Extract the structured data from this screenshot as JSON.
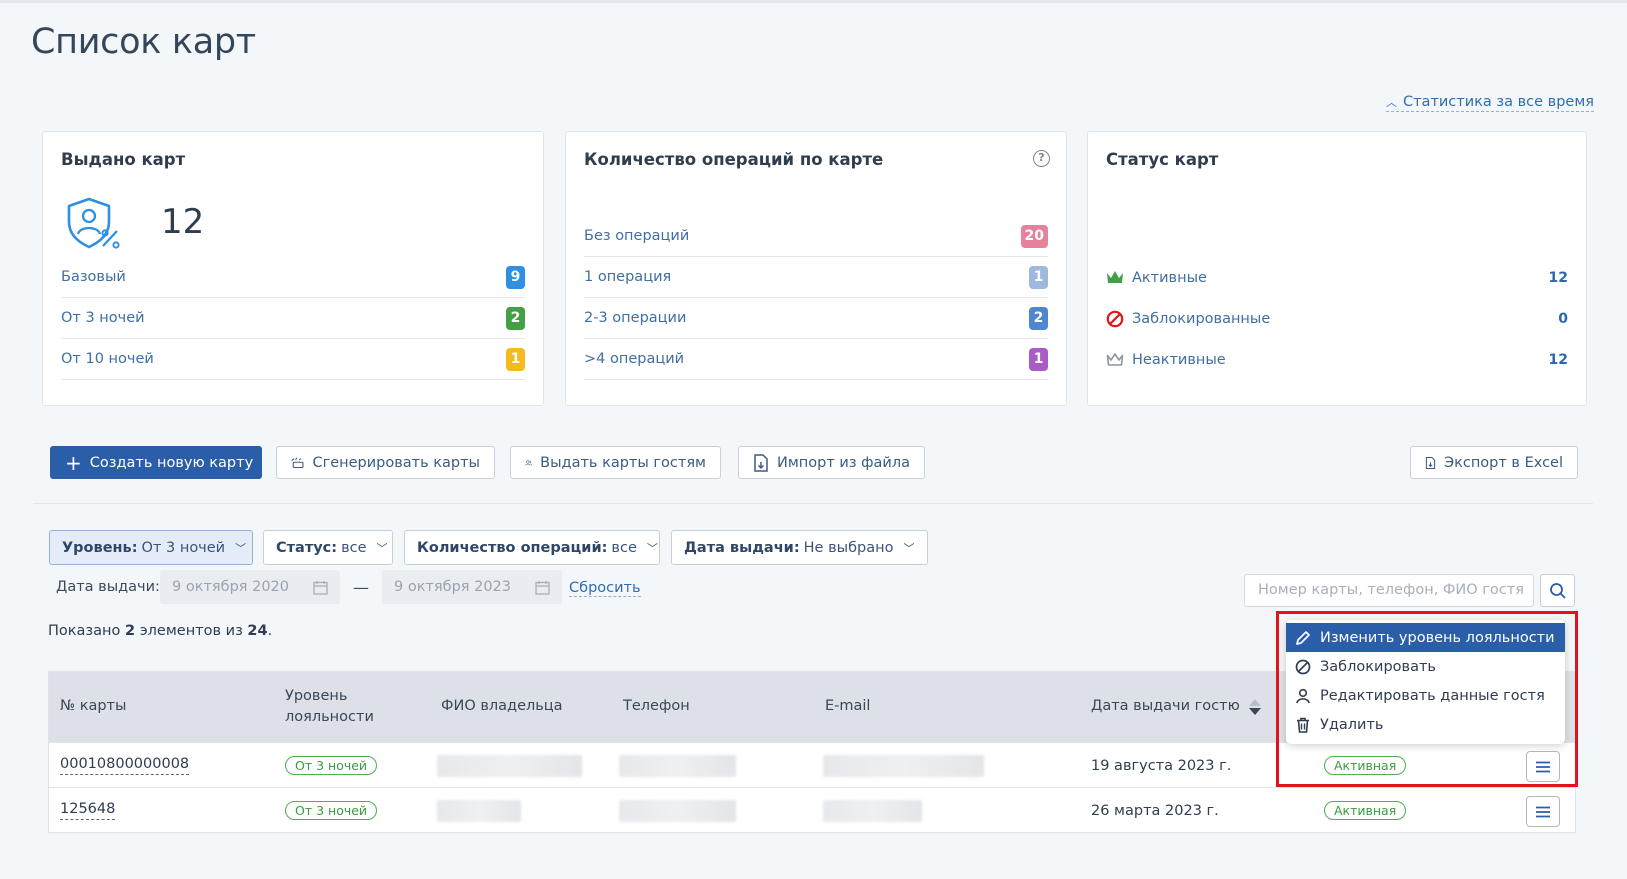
{
  "page": {
    "title": "Список карт",
    "stats_link": "Статистика за все время"
  },
  "cards": {
    "issued": {
      "title": "Выдано карт",
      "total": "12",
      "rows": [
        {
          "label": "Базовый",
          "count": "9",
          "color": "#2f8fe0"
        },
        {
          "label": "От 3 ночей",
          "count": "2",
          "color": "#43a047"
        },
        {
          "label": "От 10 ночей",
          "count": "1",
          "color": "#f6b920"
        }
      ]
    },
    "operations": {
      "title": "Количество операций по карте",
      "rows": [
        {
          "label": "Без операций",
          "count": "20",
          "color": "#e7829c"
        },
        {
          "label": "1 операция",
          "count": "1",
          "color": "#9fb8e0"
        },
        {
          "label": "2-3 операции",
          "count": "2",
          "color": "#4f86cf"
        },
        {
          "label": ">4 операций",
          "count": "1",
          "color": "#a85cc4"
        }
      ]
    },
    "status": {
      "title": "Статус карт",
      "rows": [
        {
          "label": "Активные",
          "count": "12",
          "icon": "crown-icon",
          "color": "#43a047"
        },
        {
          "label": "Заблокированные",
          "count": "0",
          "icon": "blocked-icon",
          "color": "#e1141b"
        },
        {
          "label": "Неактивные",
          "count": "12",
          "icon": "crown-outline-icon",
          "color": "#8d97a3"
        }
      ]
    }
  },
  "toolbar": {
    "create": "Создать новую карту",
    "generate": "Сгенерировать карты",
    "issue": "Выдать карты гостям",
    "import": "Импорт из файла",
    "export": "Экспорт в Excel"
  },
  "filters": {
    "level": {
      "label": "Уровень:",
      "value": "От 3 ночей"
    },
    "status": {
      "label": "Статус:",
      "value": "все"
    },
    "ops": {
      "label": "Количество операций:",
      "value": "все"
    },
    "date": {
      "label": "Дата выдачи:",
      "value": "Не выбрано"
    }
  },
  "date_range": {
    "label": "Дата выдачи:",
    "from": "9 октября 2020",
    "to": "9 октября 2023",
    "separator": "—",
    "reset": "Сбросить"
  },
  "search": {
    "placeholder": "Номер карты, телефон, ФИО гостя"
  },
  "summary": {
    "prefix": "Показано",
    "shown": "2",
    "middle": "элементов из",
    "total": "24",
    "suffix": "."
  },
  "table": {
    "columns": {
      "card": "№ карты",
      "level_1": "Уровень",
      "level_2": "лояльности",
      "owner": "ФИО владельца",
      "phone": "Телефон",
      "email": "E-mail",
      "date": "Дата выдачи гостю"
    },
    "rows": [
      {
        "card": "00010800000008",
        "level": "От 3 ночей",
        "date": "19 августа 2023 г.",
        "status": "Активная"
      },
      {
        "card": "125648",
        "level": "От 3 ночей",
        "date": "26 марта 2023 г.",
        "status": "Активная"
      }
    ]
  },
  "context_menu": {
    "items": [
      {
        "label": "Изменить уровень лояльности",
        "icon": "pencil-icon"
      },
      {
        "label": "Заблокировать",
        "icon": "block-icon"
      },
      {
        "label": "Редактировать данные гостя",
        "icon": "person-icon"
      },
      {
        "label": "Удалить",
        "icon": "trash-icon"
      }
    ]
  },
  "colors": {
    "accent": "#2a5ea8",
    "highlight_box": "#e1141b",
    "active_green": "#43a047"
  }
}
